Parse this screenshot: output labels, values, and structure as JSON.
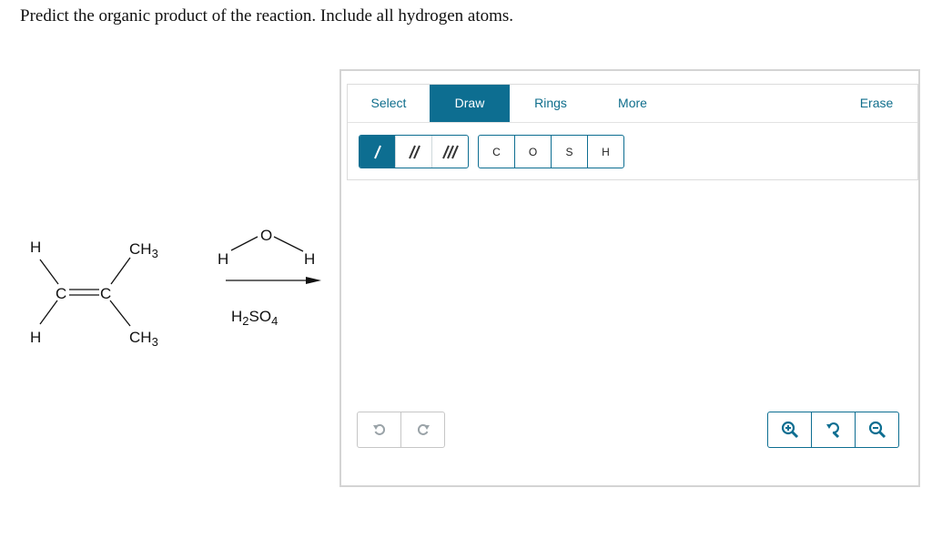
{
  "question": "Predict the organic product of the reaction. Include all hydrogen atoms.",
  "reactant": {
    "top_left_h": "H",
    "bottom_left_h": "H",
    "left_c": "C",
    "right_c": "C",
    "top_right_group": "CH3",
    "bottom_right_group": "CH3"
  },
  "reagent": {
    "water_o": "O",
    "water_h_left": "H",
    "water_h_right": "H",
    "catalyst": "H2SO4"
  },
  "editor": {
    "tabs": {
      "select": "Select",
      "draw": "Draw",
      "rings": "Rings",
      "more": "More",
      "erase": "Erase"
    },
    "atoms": [
      "C",
      "O",
      "S",
      "H"
    ],
    "bonds": [
      "single-bond-icon",
      "double-bond-icon",
      "triple-bond-icon"
    ],
    "history": [
      "undo-icon",
      "redo-icon"
    ],
    "zoom": [
      "zoom-in-icon",
      "reset-zoom-icon",
      "zoom-out-icon"
    ],
    "colors": {
      "accent": "#0d6e91",
      "tab_text": "#0f6e8c"
    }
  }
}
